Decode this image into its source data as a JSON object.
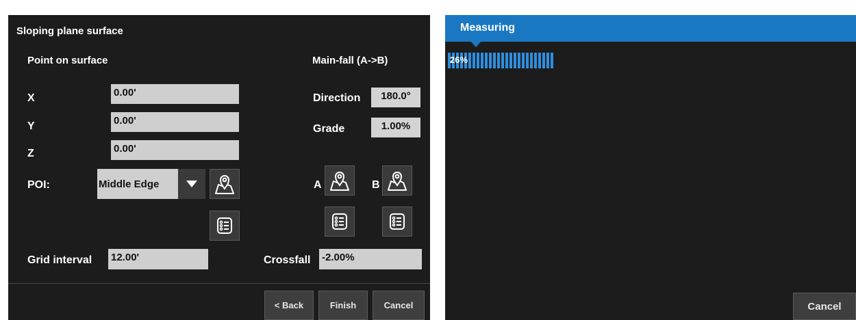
{
  "left": {
    "title": "Sloping plane surface",
    "point_section": "Point on surface",
    "mainfall_section": "Main-fall (A->B)",
    "x": {
      "label": "X",
      "value": "0.00'"
    },
    "y": {
      "label": "Y",
      "value": "0.00'"
    },
    "z": {
      "label": "Z",
      "value": "0.00'"
    },
    "direction": {
      "label": "Direction",
      "value": "180.0°"
    },
    "grade": {
      "label": "Grade",
      "value": "1.00%"
    },
    "poi": {
      "label": "POI:",
      "value": "Middle Edge"
    },
    "point_a_label": "A",
    "point_b_label": "B",
    "grid_interval": {
      "label": "Grid interval",
      "value": "12.00'"
    },
    "crossfall": {
      "label": "Crossfall",
      "value": "-2.00%"
    },
    "buttons": {
      "back": "< Back",
      "finish": "Finish",
      "cancel": "Cancel"
    }
  },
  "right": {
    "title": "Measuring",
    "progress_text": "26%",
    "progress_fraction": 0.26,
    "cancel": "Cancel"
  },
  "icons": {
    "map_pin": "map-pin-icon",
    "list": "list-icon",
    "dropdown": "chevron-down-icon"
  },
  "colors": {
    "panel_bg": "#1c1c1c",
    "field_bg": "#cfcfcf",
    "accent_blue": "#1a78c2",
    "progress_blue": "#2d8fe0",
    "button_bg": "#3e3e3e"
  }
}
